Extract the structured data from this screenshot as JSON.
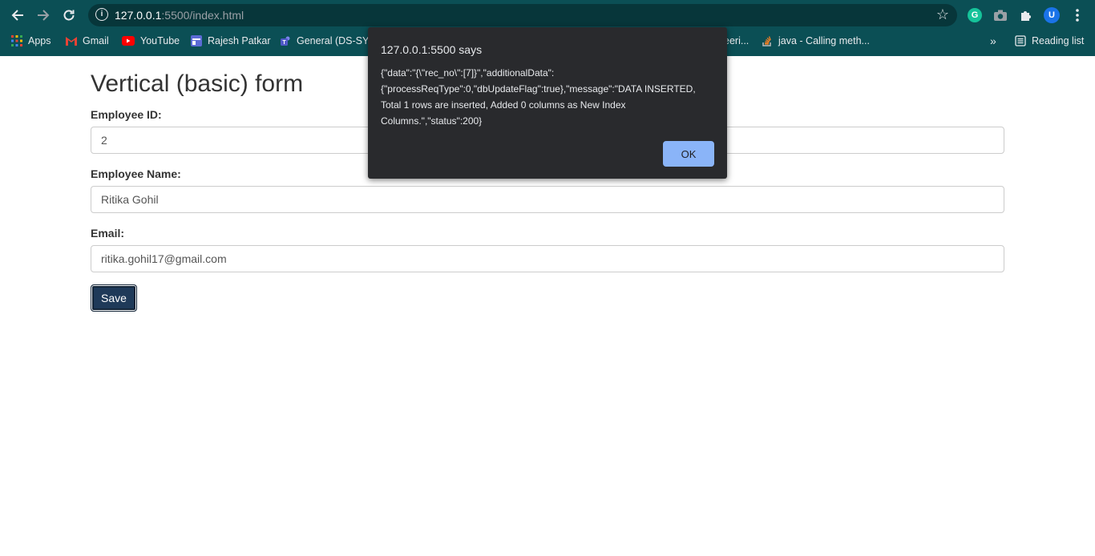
{
  "browser": {
    "url_host": "127.0.0.1",
    "url_path": ":5500/index.html",
    "extensions": [
      {
        "name": "grammarly",
        "letter": "G",
        "color": "#15c39a"
      },
      {
        "name": "profile",
        "letter": "U",
        "color": "#1a73e8"
      }
    ],
    "bookmarks": {
      "apps": "Apps",
      "gmail": "Gmail",
      "youtube": "YouTube",
      "rajesh": "Rajesh Patkar",
      "general": "General (DS-SY-",
      "eeri": "eeri...",
      "java": "java - Calling meth...",
      "reading_list": "Reading list"
    }
  },
  "form": {
    "title": "Vertical (basic) form",
    "employee_id": {
      "label": "Employee ID:",
      "value": "2"
    },
    "employee_name": {
      "label": "Employee Name:",
      "value": "Ritika Gohil"
    },
    "email": {
      "label": "Email:",
      "value": "ritika.gohil17@gmail.com"
    },
    "save_label": "Save"
  },
  "dialog": {
    "title": "127.0.0.1:5500 says",
    "message": "{\"data\":\"{\\\"rec_no\\\":[7]}\",\"additionalData\":{\"processReqType\":0,\"dbUpdateFlag\":true},\"message\":\"DATA INSERTED, Total 1 rows are inserted, Added 0 columns as New Index Columns.\",\"status\":200}",
    "ok_label": "OK"
  },
  "colors": {
    "toolbar_bg": "#0b4f55",
    "dialog_bg": "#292a2d",
    "ok_button": "#8ab4f8",
    "save_button": "#1f3a59"
  }
}
